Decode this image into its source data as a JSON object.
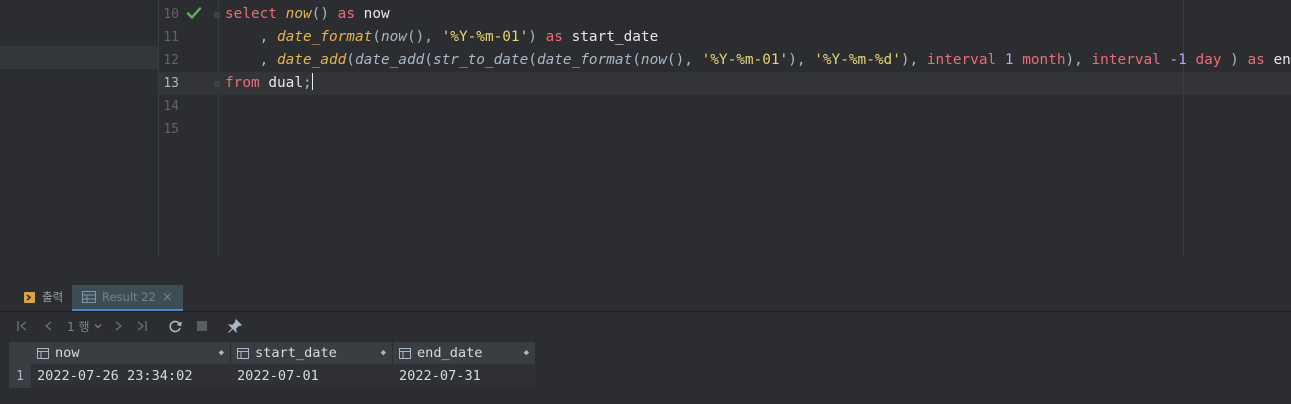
{
  "editor": {
    "line_numbers": [
      "10",
      "11",
      "12",
      "13",
      "14",
      "15"
    ],
    "active_line": "13",
    "status_icon": "check-icon"
  },
  "tabs": [
    {
      "label": "출력",
      "icon": "output-icon"
    },
    {
      "label": "Result 22",
      "icon": "table-icon",
      "close": "×"
    }
  ],
  "toolbar": {
    "row_count": "1 행",
    "icons": [
      "first-page-icon",
      "prev-page-icon",
      "next-page-icon",
      "last-page-icon",
      "refresh-icon",
      "stop-icon",
      "pin-icon"
    ]
  },
  "results": {
    "columns": [
      "now",
      "start_date",
      "end_date"
    ],
    "rows": [
      {
        "num": "1",
        "cells": [
          "2022-07-26 23:34:02",
          "2022-07-01",
          "2022-07-31"
        ]
      }
    ]
  },
  "code": {
    "l10": {
      "k1": "select",
      "f1": "now",
      "p1": "()",
      "k2": "as",
      "i1": "now"
    },
    "l11": {
      "p0": ", ",
      "f1": "date_format",
      "p1": "(",
      "f2": "now",
      "p2": "(), ",
      "s1": "'%Y-%m-01'",
      "p3": ") ",
      "k1": "as",
      "i1": "start_date"
    },
    "l12": {
      "p0": ", ",
      "f1": "date_add",
      "p1": "(",
      "f2": "date_add",
      "p2": "(",
      "f3": "str_to_date",
      "p3": "(",
      "f4": "date_format",
      "p4": "(",
      "f5": "now",
      "p5": "(), ",
      "s1": "'%Y-%m-01'",
      "p6": "), ",
      "s2": "'%Y-%m-%d'",
      "p7": "), ",
      "k1": "interval",
      "n1": "1",
      "k2": "month",
      "p8": "), ",
      "k3": "interval",
      "n2": "-1",
      "k4": "day",
      "p9": " ) ",
      "k5": "as",
      "i1": "end_date"
    },
    "l13": {
      "k1": "from",
      "i1": "dual",
      "p1": ";"
    }
  }
}
